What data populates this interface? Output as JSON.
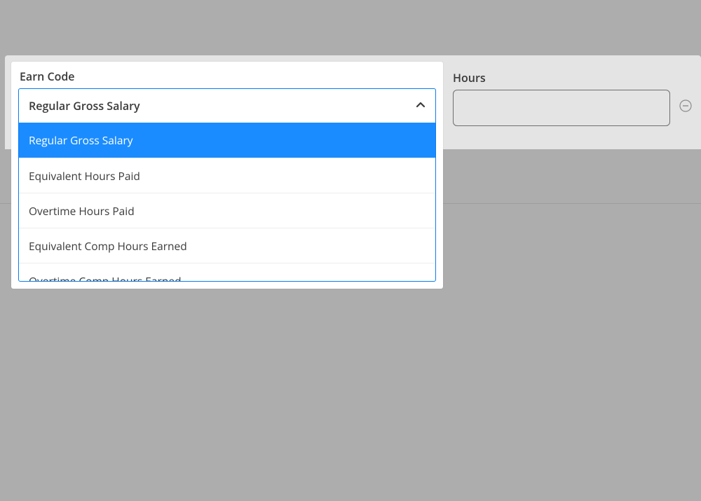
{
  "earn_code": {
    "label": "Earn Code",
    "selected": "Regular Gross Salary",
    "options": [
      "Regular Gross Salary",
      "Equivalent Hours Paid",
      "Overtime Hours Paid",
      "Equivalent Comp Hours Earned",
      "Overtime Comp Hours Earned"
    ]
  },
  "hours": {
    "label": "Hours",
    "value": ""
  }
}
